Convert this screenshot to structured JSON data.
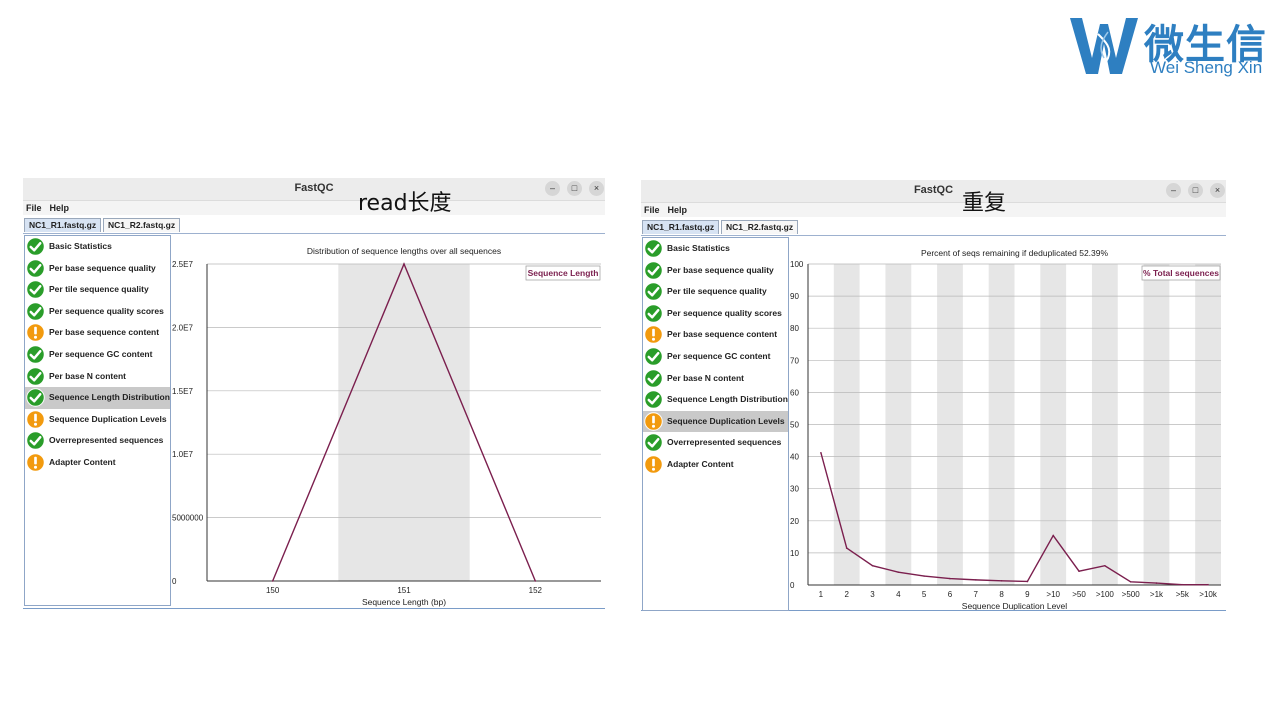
{
  "logo": {
    "cn": "微生信",
    "en": "Wei Sheng Xin",
    "color": "#2e7fc1"
  },
  "labels": {
    "left": "read长度",
    "right": "重复"
  },
  "colors": {
    "line": "#7b1f4e",
    "pass": "#2a9d2a",
    "warn": "#f29a0e",
    "band": "#e6e6e6"
  },
  "windows": [
    {
      "title": "FastQC",
      "menu": [
        "File",
        "Help"
      ],
      "tabs": [
        "NC1_R1.fastq.gz",
        "NC1_R2.fastq.gz"
      ],
      "active_tab": 0,
      "selected_module": 7,
      "modules": [
        {
          "label": "Basic Statistics",
          "status": "pass"
        },
        {
          "label": "Per base sequence quality",
          "status": "pass"
        },
        {
          "label": "Per tile sequence quality",
          "status": "pass"
        },
        {
          "label": "Per sequence quality scores",
          "status": "pass"
        },
        {
          "label": "Per base sequence content",
          "status": "warn"
        },
        {
          "label": "Per sequence GC content",
          "status": "pass"
        },
        {
          "label": "Per base N content",
          "status": "pass"
        },
        {
          "label": "Sequence Length Distribution",
          "status": "pass"
        },
        {
          "label": "Sequence Duplication Levels",
          "status": "warn"
        },
        {
          "label": "Overrepresented sequences",
          "status": "pass"
        },
        {
          "label": "Adapter Content",
          "status": "warn"
        }
      ],
      "chart_data": {
        "type": "line",
        "title": "Distribution of sequence lengths over all sequences",
        "xlabel": "Sequence Length (bp)",
        "ylabel": "",
        "categories": [
          "150",
          "151",
          "152"
        ],
        "yticks": [
          "0",
          "5000000",
          "1.0E7",
          "1.5E7",
          "2.0E7",
          "2.5E7"
        ],
        "ylim": [
          0,
          25000000
        ],
        "grid": true,
        "legend_position": "top-right",
        "series": [
          {
            "name": "Sequence Length",
            "values": [
              0,
              25000000,
              0
            ]
          }
        ]
      }
    },
    {
      "title": "FastQC",
      "menu": [
        "File",
        "Help"
      ],
      "tabs": [
        "NC1_R1.fastq.gz",
        "NC1_R2.fastq.gz"
      ],
      "active_tab": 0,
      "selected_module": 8,
      "modules": [
        {
          "label": "Basic Statistics",
          "status": "pass"
        },
        {
          "label": "Per base sequence quality",
          "status": "pass"
        },
        {
          "label": "Per tile sequence quality",
          "status": "pass"
        },
        {
          "label": "Per sequence quality scores",
          "status": "pass"
        },
        {
          "label": "Per base sequence content",
          "status": "warn"
        },
        {
          "label": "Per sequence GC content",
          "status": "pass"
        },
        {
          "label": "Per base N content",
          "status": "pass"
        },
        {
          "label": "Sequence Length Distribution",
          "status": "pass"
        },
        {
          "label": "Sequence Duplication Levels",
          "status": "warn"
        },
        {
          "label": "Overrepresented sequences",
          "status": "pass"
        },
        {
          "label": "Adapter Content",
          "status": "warn"
        }
      ],
      "chart_data": {
        "type": "line",
        "title": "Percent of seqs remaining if deduplicated 52.39%",
        "xlabel": "Sequence Duplication Level",
        "ylabel": "",
        "categories": [
          "1",
          "2",
          "3",
          "4",
          "5",
          "6",
          "7",
          "8",
          "9",
          ">10",
          ">50",
          ">100",
          ">500",
          ">1k",
          ">5k",
          ">10k"
        ],
        "yticks": [
          "0",
          "10",
          "20",
          "30",
          "40",
          "50",
          "60",
          "70",
          "80",
          "90",
          "100"
        ],
        "ylim": [
          0,
          100
        ],
        "grid": true,
        "legend_position": "top-right",
        "series": [
          {
            "name": "% Total sequences",
            "values": [
              41.2,
              11.5,
              6.0,
              4.0,
              2.8,
              2.0,
              1.6,
              1.3,
              1.1,
              15.4,
              4.3,
              6.0,
              1.0,
              0.6,
              0.1,
              0.1
            ]
          }
        ]
      }
    }
  ]
}
